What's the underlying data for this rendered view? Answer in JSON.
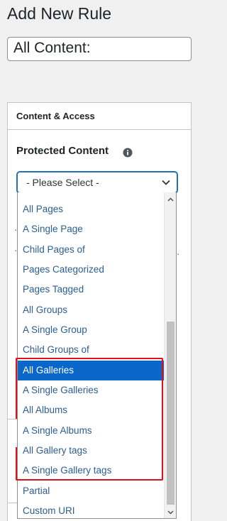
{
  "page": {
    "title": "Add New Rule"
  },
  "rule_title_input": {
    "value": "All Content:"
  },
  "postbox": {
    "header": "Content & Access",
    "section_title": "Protected Content"
  },
  "protected_select": {
    "value": "- Please Select -"
  },
  "dropdown": {
    "options": [
      "All Pages",
      "A Single Page",
      "Child Pages of",
      "Pages Categorized",
      "Pages Tagged",
      "All Groups",
      "A Single Group",
      "Child Groups of",
      "All Galleries",
      "A Single Galleries",
      "All Albums",
      "A Single Albums",
      "All Gallery tags",
      "A Single Gallery tags",
      "Partial",
      "Custom URI"
    ],
    "selected": "All Galleries"
  },
  "colors": {
    "link_text": "#2c5d8f",
    "selected_bg": "#0a66c8",
    "highlight": "#e0101a",
    "focus_border": "#2271b1"
  },
  "icons": {
    "info": "info-circle-icon",
    "chevron": "chevron-down-icon"
  }
}
